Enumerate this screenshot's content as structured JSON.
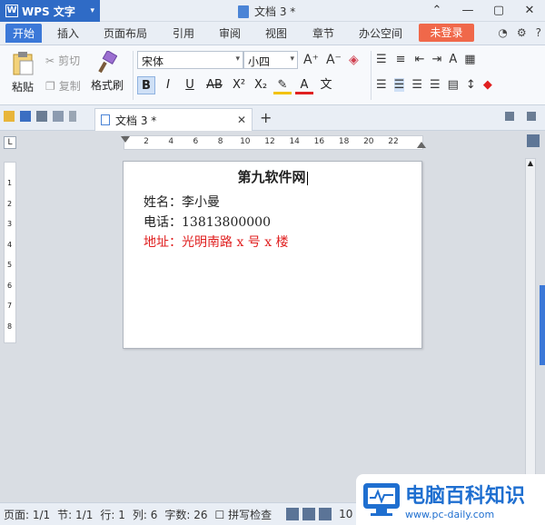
{
  "titlebar": {
    "app_button": "WPS 文字",
    "doc_title": "文档 3 *"
  },
  "menu": {
    "tabs": [
      "开始",
      "插入",
      "页面布局",
      "引用",
      "审阅",
      "视图",
      "章节",
      "办公空间"
    ],
    "login": "未登录"
  },
  "ribbon": {
    "paste": "粘贴",
    "cut": "剪切",
    "copy": "复制",
    "format_painter": "格式刷",
    "font_name": "宋体",
    "font_size": "小四"
  },
  "docbar": {
    "tab_title": "文档 3 *"
  },
  "ruler": {
    "h_ticks": [
      "2",
      "4",
      "6",
      "8",
      "10",
      "12",
      "14",
      "16",
      "18",
      "20",
      "22"
    ],
    "v_ticks": [
      "1",
      "2",
      "3",
      "4",
      "5",
      "6",
      "7",
      "8"
    ]
  },
  "document": {
    "title": "第九软件网",
    "line1": "姓名：李小曼",
    "line2": "电话：13813800000",
    "line3": "地址：光明南路 x 号 x 楼"
  },
  "status": {
    "page": "页面: 1/1",
    "section": "节: 1/1",
    "row": "行: 1",
    "col": "列: 6",
    "word_count": "字数: 26",
    "spell_check": "拼写检查",
    "zoom": "10"
  },
  "watermark": {
    "title": "电脑百科知识",
    "url": "www.pc-daily.com"
  },
  "colors": {
    "accent": "#3b78d8",
    "login": "#f0684a",
    "red_text": "#e02020"
  }
}
